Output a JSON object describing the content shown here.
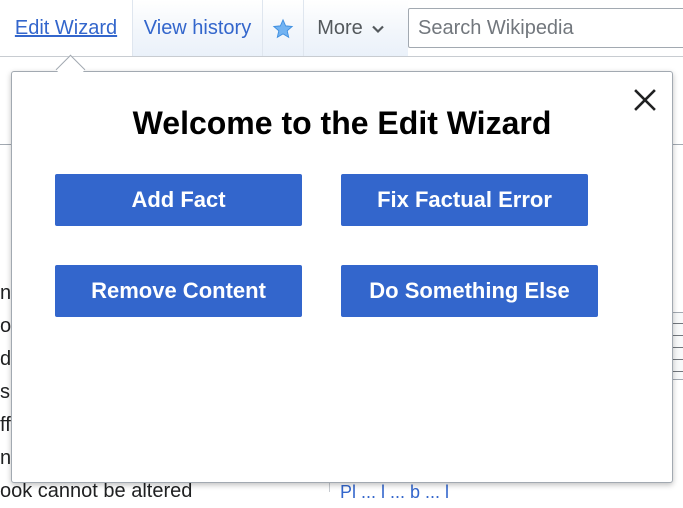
{
  "tabs": {
    "edit_wizard": "Edit Wizard",
    "view_history": "View history",
    "watch_icon": "star-icon",
    "more": "More",
    "more_icon": "chevron-down-icon"
  },
  "search": {
    "placeholder": "Search Wikipedia"
  },
  "article_fragments": [
    "n",
    "oc",
    "d",
    "s",
    "ff",
    "ns",
    "ook cannot be altered"
  ],
  "bottom_link": "Pl ... l ... b ... l",
  "wizard": {
    "title": "Welcome to the Edit Wizard",
    "close_icon": "close-icon",
    "buttons": {
      "add_fact": "Add Fact",
      "fix_factual_error": "Fix Factual Error",
      "remove_content": "Remove Content",
      "do_something_else": "Do Something Else"
    }
  },
  "colors": {
    "link": "#3366cc",
    "button": "#3366cc",
    "button_text": "#ffffff",
    "border": "#a2a9b1"
  }
}
